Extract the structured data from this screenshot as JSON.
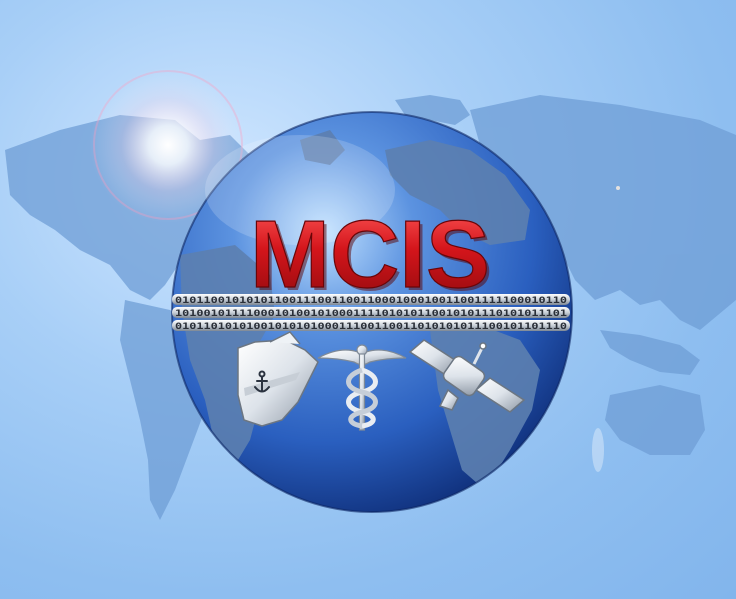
{
  "logo": {
    "wordmark": "MCIS",
    "binary_rows": [
      "0101100101010110011100110011000100010011001111100010110",
      "1010010111100010100101000111101010110010101110101011101",
      "0101101010100101010100011100110011010101011100101101110"
    ]
  },
  "icons": [
    "globe-icon",
    "ship-icon",
    "anchor-icon",
    "caduceus-icon",
    "satellite-icon",
    "world-map-icon"
  ],
  "colors": {
    "background": "#9dc6f4",
    "map_land": "#6f9ed6",
    "globe_ocean": "#2f67c4",
    "wordmark_red": "#cc1116"
  }
}
